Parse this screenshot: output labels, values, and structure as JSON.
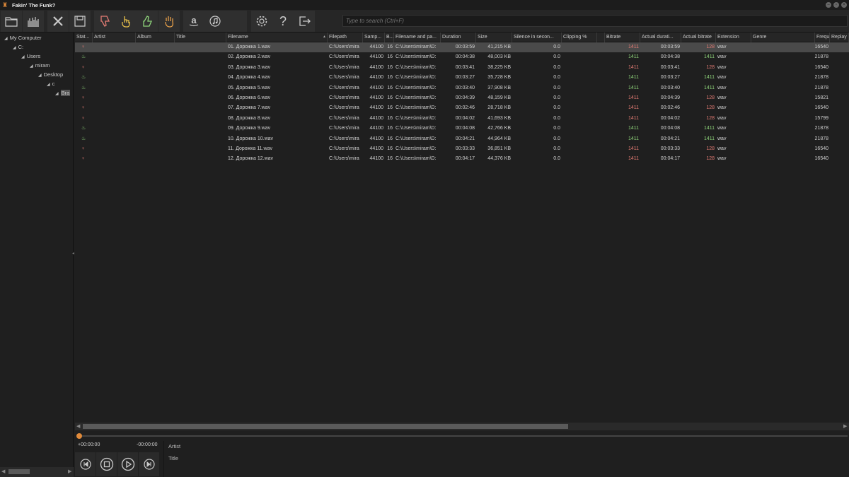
{
  "window": {
    "title": "Fakin' The Funk?"
  },
  "search": {
    "placeholder": "Type to search (Ctrl+F)"
  },
  "toolbar": {
    "icons": [
      "folder-icon",
      "spectrum-icon",
      "remove-icon",
      "save-icon",
      "thumbs-down-icon",
      "hand-pointing-icon",
      "thumbs-up-icon",
      "hand-stop-icon",
      "amazon-icon",
      "itunes-icon",
      "blank",
      "settings-icon",
      "help-icon",
      "exit-icon"
    ]
  },
  "tree": {
    "items": [
      {
        "label": "My Computer",
        "arrow": "◢"
      },
      {
        "label": "C:",
        "arrow": "◢"
      },
      {
        "label": "Users",
        "arrow": "◢"
      },
      {
        "label": "miram",
        "arrow": "◢"
      },
      {
        "label": "Desktop",
        "arrow": "◢"
      },
      {
        "label": "c",
        "arrow": "◢"
      },
      {
        "label": "Bra",
        "arrow": "◢"
      }
    ]
  },
  "columns": [
    "Stat...",
    "Artist",
    "Album",
    "Title",
    "Filename",
    "Filepath",
    "Samp...",
    "B...",
    "Filename and pa...",
    "Duration",
    "Size",
    "Silence in secon...",
    "Clipping %",
    "",
    "Bitrate",
    "Actual durati...",
    "Actual bitrate",
    "Extension",
    "Genre",
    "Frequency",
    "Replay"
  ],
  "rows": [
    {
      "status": "bad",
      "filename": "01. Дорожка 1.wav",
      "filepath": "C:\\Users\\mira",
      "samp": "44100",
      "bits": "16",
      "fullpath": "C:\\Users\\miram\\D:",
      "duration": "00:03:59",
      "size": "41,215 KB",
      "silence": "0.0",
      "bitrate": "1411",
      "actual_dur": "00:03:59",
      "actual_bitrate": "128",
      "ext": "wav",
      "freq": "16540"
    },
    {
      "status": "good",
      "filename": "02. Дорожка 2.wav",
      "filepath": "C:\\Users\\mira",
      "samp": "44100",
      "bits": "16",
      "fullpath": "C:\\Users\\miram\\D:",
      "duration": "00:04:38",
      "size": "48,003 KB",
      "silence": "0.0",
      "bitrate": "1411",
      "actual_dur": "00:04:38",
      "actual_bitrate": "1411",
      "ext": "wav",
      "freq": "21878"
    },
    {
      "status": "bad",
      "filename": "03. Дорожка 3.wav",
      "filepath": "C:\\Users\\mira",
      "samp": "44100",
      "bits": "16",
      "fullpath": "C:\\Users\\miram\\D:",
      "duration": "00:03:41",
      "size": "38,225 KB",
      "silence": "0.0",
      "bitrate": "1411",
      "actual_dur": "00:03:41",
      "actual_bitrate": "128",
      "ext": "wav",
      "freq": "16540"
    },
    {
      "status": "good",
      "filename": "04. Дорожка 4.wav",
      "filepath": "C:\\Users\\mira",
      "samp": "44100",
      "bits": "16",
      "fullpath": "C:\\Users\\miram\\D:",
      "duration": "00:03:27",
      "size": "35,728 KB",
      "silence": "0.0",
      "bitrate": "1411",
      "actual_dur": "00:03:27",
      "actual_bitrate": "1411",
      "ext": "wav",
      "freq": "21878"
    },
    {
      "status": "good",
      "filename": "05. Дорожка 5.wav",
      "filepath": "C:\\Users\\mira",
      "samp": "44100",
      "bits": "16",
      "fullpath": "C:\\Users\\miram\\D:",
      "duration": "00:03:40",
      "size": "37,908 KB",
      "silence": "0.0",
      "bitrate": "1411",
      "actual_dur": "00:03:40",
      "actual_bitrate": "1411",
      "ext": "wav",
      "freq": "21878"
    },
    {
      "status": "bad",
      "filename": "06. Дорожка 6.wav",
      "filepath": "C:\\Users\\mira",
      "samp": "44100",
      "bits": "16",
      "fullpath": "C:\\Users\\miram\\D:",
      "duration": "00:04:39",
      "size": "48,159 KB",
      "silence": "0.0",
      "bitrate": "1411",
      "actual_dur": "00:04:39",
      "actual_bitrate": "128",
      "ext": "wav",
      "freq": "15821"
    },
    {
      "status": "bad",
      "filename": "07. Дорожка 7.wav",
      "filepath": "C:\\Users\\mira",
      "samp": "44100",
      "bits": "16",
      "fullpath": "C:\\Users\\miram\\D:",
      "duration": "00:02:46",
      "size": "28,718 KB",
      "silence": "0.0",
      "bitrate": "1411",
      "actual_dur": "00:02:46",
      "actual_bitrate": "128",
      "ext": "wav",
      "freq": "16540"
    },
    {
      "status": "bad",
      "filename": "08. Дорожка 8.wav",
      "filepath": "C:\\Users\\mira",
      "samp": "44100",
      "bits": "16",
      "fullpath": "C:\\Users\\miram\\D:",
      "duration": "00:04:02",
      "size": "41,693 KB",
      "silence": "0.0",
      "bitrate": "1411",
      "actual_dur": "00:04:02",
      "actual_bitrate": "128",
      "ext": "wav",
      "freq": "15799"
    },
    {
      "status": "good",
      "filename": "09. Дорожка 9.wav",
      "filepath": "C:\\Users\\mira",
      "samp": "44100",
      "bits": "16",
      "fullpath": "C:\\Users\\miram\\D:",
      "duration": "00:04:08",
      "size": "42,766 KB",
      "silence": "0.0",
      "bitrate": "1411",
      "actual_dur": "00:04:08",
      "actual_bitrate": "1411",
      "ext": "wav",
      "freq": "21878"
    },
    {
      "status": "good",
      "filename": "10. Дорожка 10.wav",
      "filepath": "C:\\Users\\mira",
      "samp": "44100",
      "bits": "16",
      "fullpath": "C:\\Users\\miram\\D:",
      "duration": "00:04:21",
      "size": "44,964 KB",
      "silence": "0.0",
      "bitrate": "1411",
      "actual_dur": "00:04:21",
      "actual_bitrate": "1411",
      "ext": "wav",
      "freq": "21878"
    },
    {
      "status": "bad",
      "filename": "11. Дорожка 11.wav",
      "filepath": "C:\\Users\\mira",
      "samp": "44100",
      "bits": "16",
      "fullpath": "C:\\Users\\miram\\D:",
      "duration": "00:03:33",
      "size": "36,851 KB",
      "silence": "0.0",
      "bitrate": "1411",
      "actual_dur": "00:03:33",
      "actual_bitrate": "128",
      "ext": "wav",
      "freq": "16540"
    },
    {
      "status": "bad",
      "filename": "12. Дорожка 12.wav",
      "filepath": "C:\\Users\\mira",
      "samp": "44100",
      "bits": "16",
      "fullpath": "C:\\Users\\miram\\D:",
      "duration": "00:04:17",
      "size": "44,376 KB",
      "silence": "0.0",
      "bitrate": "1411",
      "actual_dur": "00:04:17",
      "actual_bitrate": "128",
      "ext": "wav",
      "freq": "16540"
    }
  ],
  "player": {
    "elapsed": "+00:00:00",
    "remaining": "-00:00:00",
    "artist_label": "Artist",
    "title_label": "Title"
  },
  "colors": {
    "bad": "#e47c74",
    "good": "#8ed37a",
    "accent": "#e08a3a"
  }
}
